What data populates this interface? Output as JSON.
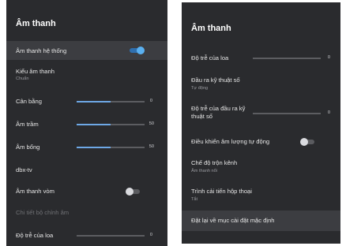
{
  "colors": {
    "panel_bg": "#2a2b2e",
    "selected_bg": "#3c3d41",
    "accent": "#6ea8e6",
    "toggle_on": "#5ab0f0"
  },
  "left": {
    "title": "Âm thanh",
    "items": {
      "system_sound": {
        "label": "Âm thanh hệ thống",
        "toggle": "on"
      },
      "sound_style": {
        "label": "Kiểu âm thanh",
        "value": "Chuẩn"
      },
      "balance": {
        "label": "Cân bằng",
        "value": "0",
        "level": 0.5
      },
      "bass": {
        "label": "Âm trầm",
        "value": "50",
        "level": 0.5
      },
      "treble": {
        "label": "Âm bổng",
        "value": "50",
        "level": 0.5
      },
      "dbx": {
        "label": "dbx-tv"
      },
      "surround": {
        "label": "Âm thanh vòm",
        "toggle": "off"
      },
      "equalizer": {
        "label": "Chi tiết bộ chỉnh âm",
        "disabled": true
      },
      "speaker_delay": {
        "label": "Độ trễ của loa",
        "value": "0",
        "level": 0.0
      }
    }
  },
  "right": {
    "title": "Âm thanh",
    "items": {
      "speaker_delay": {
        "label": "Độ trễ của loa",
        "value": "0",
        "level": 0.0
      },
      "digital_output": {
        "label": "Đầu ra kỹ thuật số",
        "value": "Tự động"
      },
      "digital_delay": {
        "label_line1": "Độ trễ của đầu ra kỹ",
        "label_line2": "thuật số",
        "value": "0",
        "level": 0.0
      },
      "auto_volume": {
        "label": "Điều khiển âm lượng tự động",
        "toggle": "off"
      },
      "downmix": {
        "label": "Chế độ trộn kênh",
        "value": "Âm thanh nổi"
      },
      "dialog": {
        "label": "Trình cải tiến hộp thoại",
        "value": "Tắt"
      },
      "reset": {
        "label": "Đặt lại về mục cài đặt mặc định"
      }
    }
  }
}
